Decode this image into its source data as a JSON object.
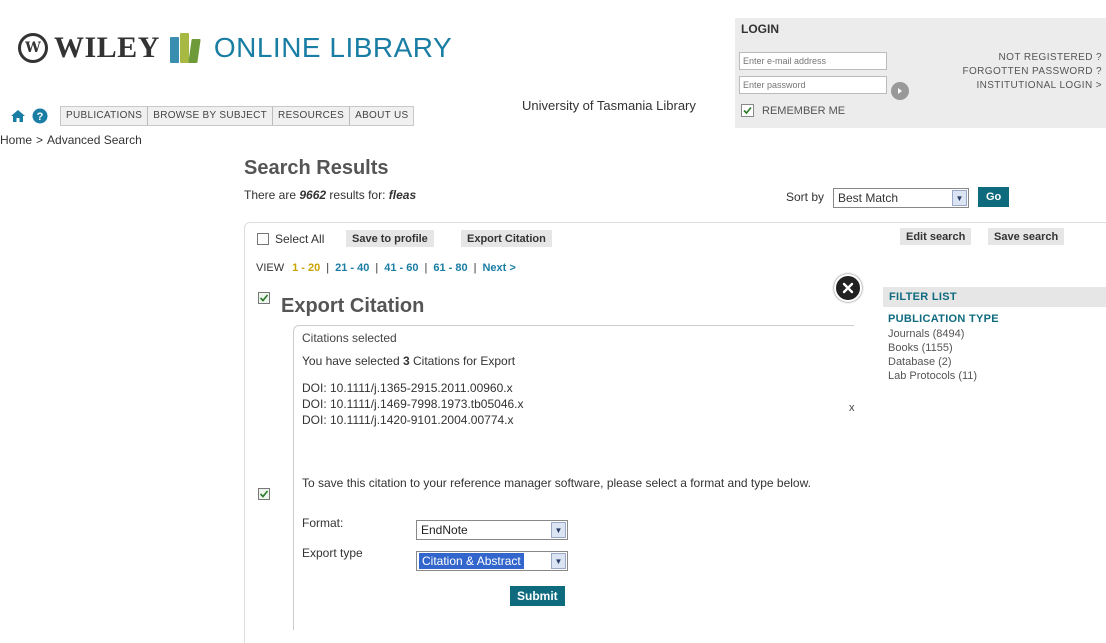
{
  "header": {
    "brand_wiley": "WILEY",
    "brand_online": "ONLINE LIBRARY",
    "nav": [
      "PUBLICATIONS",
      "BROWSE BY SUBJECT",
      "RESOURCES",
      "ABOUT US"
    ],
    "library_name": "University of Tasmania Library"
  },
  "login": {
    "title": "LOGIN",
    "email_placeholder": "Enter e-mail address",
    "password_placeholder": "Enter password",
    "remember_me": "REMEMBER ME",
    "links": [
      "NOT REGISTERED ?",
      "FORGOTTEN PASSWORD ?",
      "INSTITUTIONAL LOGIN >"
    ]
  },
  "breadcrumb": {
    "home": "Home",
    "separator": ">",
    "current": "Advanced Search"
  },
  "results": {
    "title": "Search Results",
    "count_prefix": "There are",
    "count": "9662",
    "count_mid": "results for:",
    "query": "fleas",
    "sort_label": "Sort by",
    "sort_value": "Best Match",
    "go": "Go",
    "select_all": "Select All",
    "save_to_profile": "Save to profile",
    "export_citation": "Export Citation",
    "edit_search": "Edit search",
    "save_search": "Save search",
    "view_label": "VIEW",
    "view_ranges": [
      "1 - 20",
      "21 - 40",
      "41 - 60",
      "61 - 80",
      "Next >"
    ],
    "stray_text": "x"
  },
  "filter": {
    "head": "FILTER LIST",
    "sub": "PUBLICATION TYPE",
    "items": [
      "Journals (8494)",
      "Books (1155)",
      "Database (2)",
      "Lab Protocols (11)"
    ]
  },
  "modal": {
    "title": "Export Citation",
    "subtitle": "Citations selected",
    "selected_prefix": "You have selected",
    "selected_count": "3",
    "selected_suffix": "Citations for Export",
    "dois": [
      "DOI: 10.1111/j.1365-2915.2011.00960.x",
      "DOI: 10.1111/j.1469-7998.1973.tb05046.x",
      "DOI: 10.1111/j.1420-9101.2004.00774.x"
    ],
    "instructions": "To save this citation to your reference manager software, please select a format and type below.",
    "format_label": "Format:",
    "format_value": "EndNote",
    "export_type_label": "Export type",
    "export_type_value": "Citation & Abstract",
    "submit": "Submit"
  },
  "colors": {
    "teal": "#0e6b7e",
    "link_blue": "#1a7ea4",
    "current_page": "#c9a300"
  }
}
